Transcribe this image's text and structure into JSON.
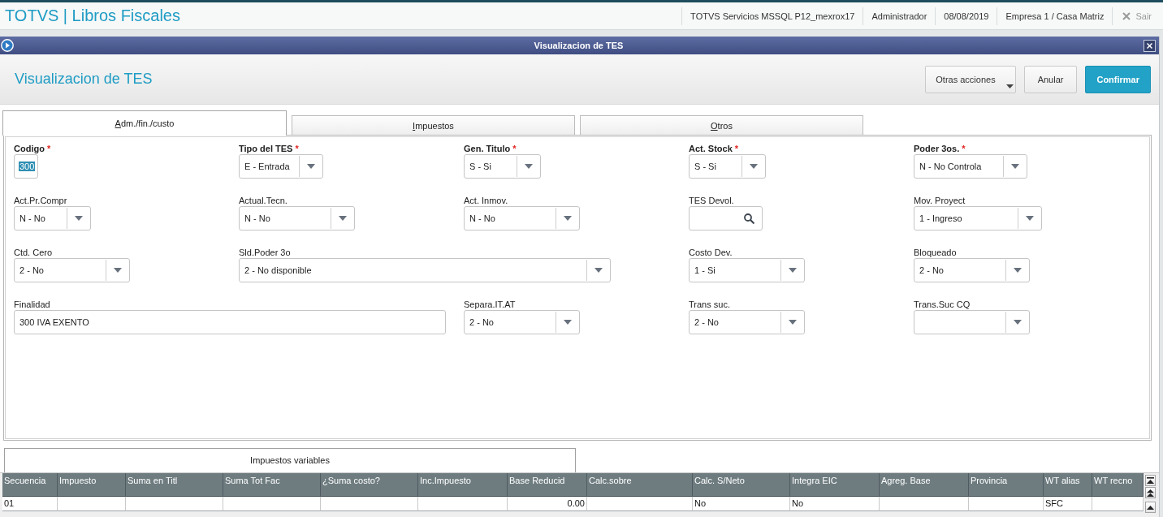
{
  "app_bar": {
    "title": "TOTVS | Libros Fiscales",
    "info": [
      "TOTVS Servicios MSSQL P12_mexrox17",
      "Administrador",
      "08/08/2019",
      "Empresa 1 / Casa Matriz"
    ],
    "exit": {
      "label": "Sair",
      "disabled": true
    }
  },
  "window": {
    "title": "Visualizacion de TES"
  },
  "header": {
    "title": "Visualizacion de TES",
    "buttons": [
      {
        "label": "Otras acciones",
        "kind": "menu"
      },
      {
        "label": "Anular",
        "kind": "secondary"
      },
      {
        "label": "Confirmar",
        "kind": "primary"
      }
    ]
  },
  "tabs": [
    {
      "label": "Adm./fin./custo",
      "selected": true
    },
    {
      "label": "Impuestos",
      "selected": false
    },
    {
      "label": "Otros",
      "selected": false
    }
  ],
  "form": {
    "rows": [
      {
        "fields": [
          {
            "label": "Codigo",
            "required_mark": "*",
            "kind": "text",
            "value": "300",
            "text_selected": true
          },
          {
            "label": "Tipo del TES",
            "required_mark": "*",
            "kind": "select",
            "value": "E - Entrada"
          },
          {
            "label": "Gen. Titulo",
            "required_mark": "*",
            "kind": "select",
            "value": "S - Si"
          },
          {
            "label": "Act. Stock",
            "required_mark": "*",
            "kind": "select",
            "value": "S - Si"
          },
          {
            "label": "Poder 3os.",
            "required_mark": "*",
            "kind": "select",
            "value": "N - No Controla"
          }
        ]
      },
      {
        "fields": [
          {
            "label": "Act.Pr.Compr",
            "kind": "select",
            "value": "N - No"
          },
          {
            "label": "Actual.Tecn.",
            "kind": "select",
            "value": "N - No"
          },
          {
            "label": "Act. Inmov.",
            "kind": "select",
            "value": "N - No"
          },
          {
            "label": "TES Devol.",
            "kind": "lookup"
          },
          {
            "label": "Mov. Proyect",
            "kind": "select",
            "value": "1 - Ingreso"
          }
        ]
      },
      {
        "fields": [
          {
            "label": "Ctd. Cero",
            "kind": "select",
            "value": "2 - No"
          },
          {
            "label": "Sld.Poder 3o",
            "kind": "select",
            "value": "2 - No disponible"
          },
          {
            "label": "Costo Dev.",
            "kind": "select",
            "value": "1 - Si"
          },
          {
            "label": "Bloqueado",
            "kind": "select",
            "value": "2 - No"
          }
        ]
      },
      {
        "fields": [
          {
            "label": "Finalidad",
            "kind": "text",
            "value": "300 IVA EXENTO",
            "text_selected": false
          },
          {
            "label": "Separa.IT.AT",
            "kind": "select",
            "value": "2 - No"
          },
          {
            "label": "Trans suc.",
            "kind": "select",
            "value": "2 - No"
          },
          {
            "label": "Trans.Suc CQ",
            "kind": "select"
          }
        ]
      }
    ]
  },
  "grid": {
    "tab": "Impuestos variables",
    "columns": [
      {
        "label": "Secuencia",
        "kind": "text"
      },
      {
        "label": "Impuesto",
        "kind": "text"
      },
      {
        "label": "Suma en Titl",
        "kind": "text"
      },
      {
        "label": "Suma Tot Fac",
        "kind": "text"
      },
      {
        "label": "¿Suma costo?",
        "kind": "text"
      },
      {
        "label": "Inc.Impuesto",
        "kind": "text"
      },
      {
        "label": "Base Reducid",
        "kind": "number"
      },
      {
        "label": "Calc.sobre",
        "kind": "text"
      },
      {
        "label": "Calc. S/Neto",
        "kind": "text"
      },
      {
        "label": "Integra EIC",
        "kind": "text"
      },
      {
        "label": "Agreg. Base",
        "kind": "text"
      },
      {
        "label": "Provincia",
        "kind": "text"
      },
      {
        "label": "WT alias",
        "kind": "text"
      },
      {
        "label": "WT recno",
        "kind": "text"
      }
    ],
    "rows": [
      [
        "01",
        null,
        null,
        null,
        null,
        null,
        "0.00",
        null,
        "No",
        "No",
        null,
        null,
        "SFC",
        null
      ]
    ]
  }
}
